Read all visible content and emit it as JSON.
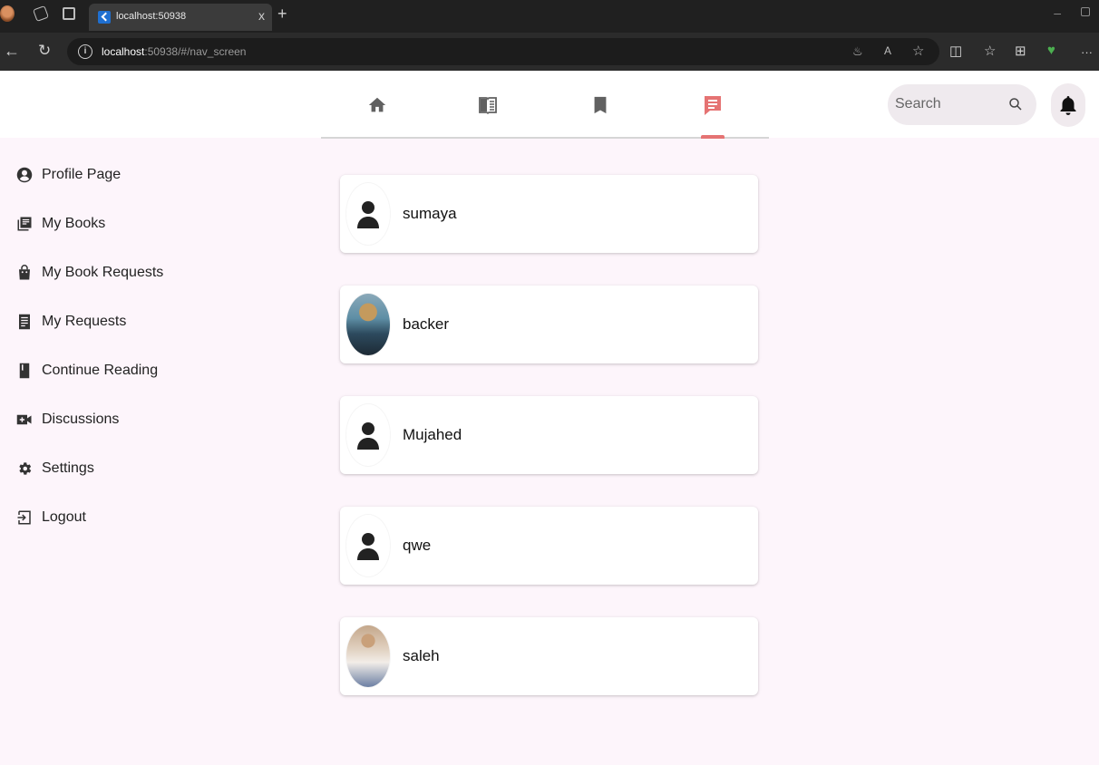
{
  "browser": {
    "tab_title": "localhost:50938",
    "tab_close": "x",
    "new_tab": "+",
    "url_host": "localhost",
    "url_rest": ":50938/#/nav_screen",
    "toolbar_more": "···"
  },
  "header": {
    "nav_items": [
      {
        "name": "home",
        "icon": "home-icon",
        "active": false
      },
      {
        "name": "books",
        "icon": "book-icon",
        "active": false
      },
      {
        "name": "bookmarks",
        "icon": "bookmark-icon",
        "active": false
      },
      {
        "name": "chats",
        "icon": "chat-list-icon",
        "active": true
      }
    ],
    "search_placeholder": "Search",
    "accent_color": "#e57373"
  },
  "sidebar": {
    "items": [
      {
        "label": "Profile Page",
        "icon": "account-circle-icon"
      },
      {
        "label": "My Books",
        "icon": "library-books-icon"
      },
      {
        "label": "My Book Requests",
        "icon": "shopping-bag-icon"
      },
      {
        "label": "My Requests",
        "icon": "receipt-icon"
      },
      {
        "label": "Continue Reading",
        "icon": "book-icon"
      },
      {
        "label": "Discussions",
        "icon": "video-call-icon"
      },
      {
        "label": "Settings",
        "icon": "settings-icon"
      },
      {
        "label": "Logout",
        "icon": "logout-icon"
      }
    ]
  },
  "users": [
    {
      "name": "sumaya",
      "avatar": "default-person-icon"
    },
    {
      "name": "backer",
      "avatar": "user-photo"
    },
    {
      "name": "Mujahed",
      "avatar": "default-person-icon"
    },
    {
      "name": "qwe",
      "avatar": "default-person-icon"
    },
    {
      "name": "saleh",
      "avatar": "user-photo"
    }
  ]
}
